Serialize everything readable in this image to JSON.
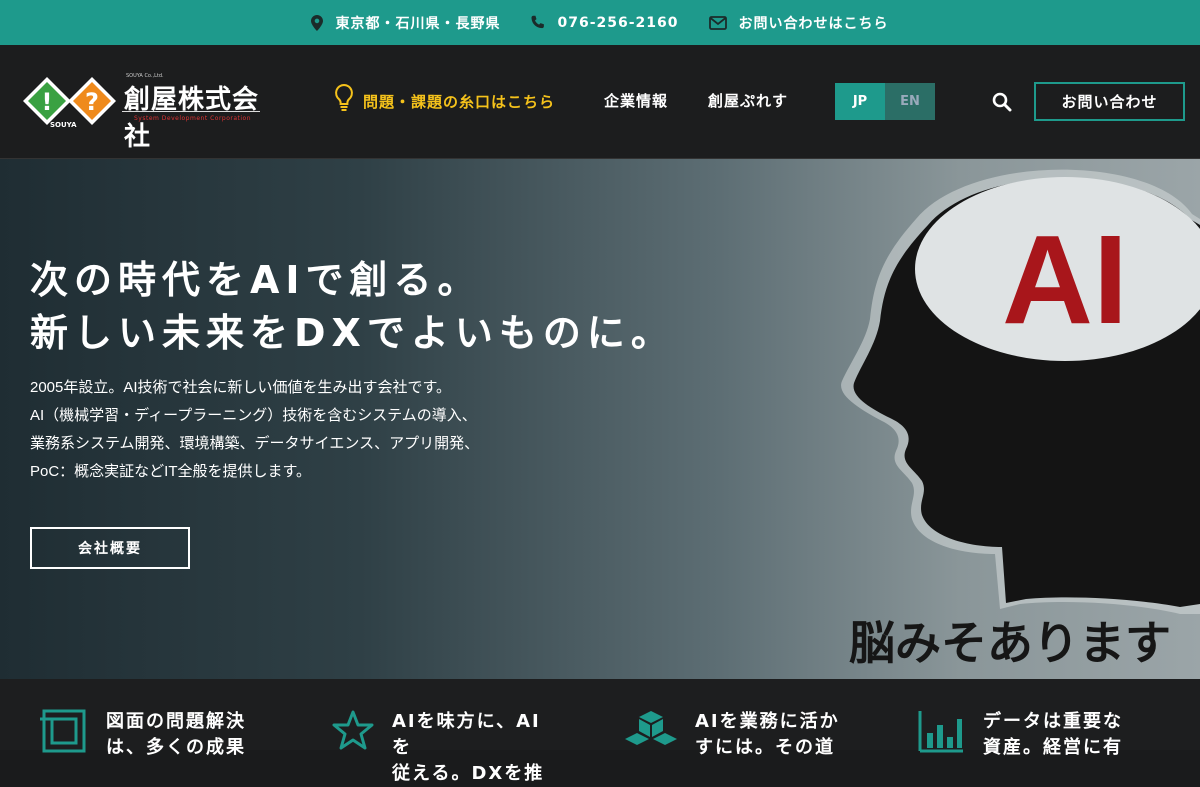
{
  "topbar": {
    "location": "東京都・石川県・長野県",
    "phone": "076-256-2160",
    "contact": "お問い合わせはこちら"
  },
  "header": {
    "logo_name": "創屋株式会社",
    "logo_en": "System Development Corporation",
    "logo_small": "SOUYA Co.,Ltd.",
    "logo_badge": "SOUYA",
    "nav": {
      "problem": "問題・課題の糸口はこちら",
      "company": "企業情報",
      "press": "創屋ぷれす"
    },
    "lang": {
      "jp": "JP",
      "en": "EN"
    },
    "contact_button": "お問い合わせ"
  },
  "hero": {
    "title_line1": "次の時代をAIで創る。",
    "title_line2": "新しい未来をDXでよいものに。",
    "desc_line1": "2005年設立。AI技術で社会に新しい価値を生み出す会社です。",
    "desc_line2": "AI（機械学習・ディープラーニング）技術を含むシステムの導入、",
    "desc_line3": "業務系システム開発、環境構築、データサイエンス、アプリ開発、",
    "desc_line4": "PoC：概念実証などIT全般を提供します。",
    "button": "会社概要",
    "art_ai": "AI",
    "art_caption": "脳みそあります"
  },
  "features": [
    {
      "line1": "図面の問題解決",
      "line2": "は、多くの成果"
    },
    {
      "line1": "AIを味方に、AIを",
      "line2": "従える。DXを推"
    },
    {
      "line1": "AIを業務に活か",
      "line2": "すには。その道"
    },
    {
      "line1": "データは重要な",
      "line2": "資産。経営に有"
    }
  ],
  "colors": {
    "accent": "#1e9a8c",
    "highlight": "#f5c21b",
    "ai_red": "#a8161b"
  }
}
